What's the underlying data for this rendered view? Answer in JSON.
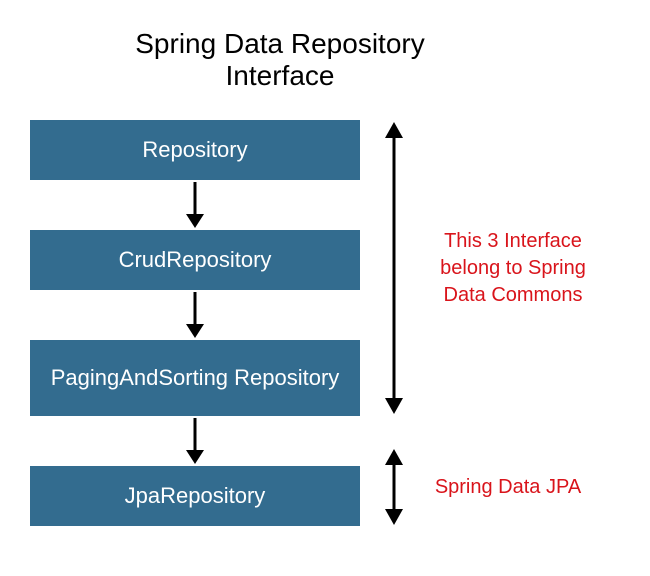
{
  "title": "Spring Data Repository Interface",
  "boxes": {
    "repository": "Repository",
    "crud": "CrudRepository",
    "paging": "PagingAndSorting Repository",
    "jpa": "JpaRepository"
  },
  "annotations": {
    "commons": "This 3 Interface belong to Spring Data Commons",
    "jpa": "Spring Data JPA"
  },
  "colors": {
    "box_bg": "#336c8f",
    "box_text": "#ffffff",
    "annotation_text": "#d9141b",
    "arrow": "#000000"
  }
}
